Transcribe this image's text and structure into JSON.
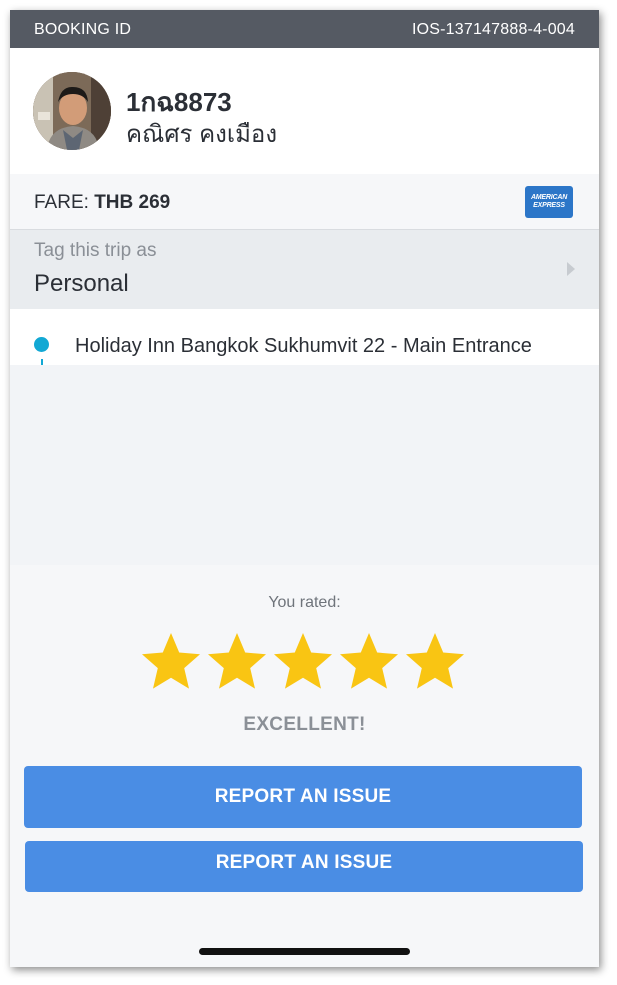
{
  "header": {
    "booking_label": "BOOKING ID",
    "booking_id": "IOS-137147888-4-004"
  },
  "driver": {
    "plate": "1กฉ8873",
    "name": "คณิศร คงเมือง",
    "avatar_icon": "driver-photo"
  },
  "fare": {
    "label": "FARE: ",
    "amount": "THB 269",
    "card_icon": "american-express-card-icon",
    "card_text_line1": "AMERICAN",
    "card_text_line2": "EXPRESS"
  },
  "tag": {
    "hint": "Tag this trip as",
    "value": "Personal"
  },
  "route": {
    "pickup": "Holiday Inn Bangkok Sukhumvit 22 - Main Entrance"
  },
  "rating": {
    "you_rated": "You rated:",
    "stars": 5,
    "stars_max": 5,
    "result": "EXCELLENT!",
    "star_color": "#f9c513"
  },
  "actions": {
    "report_primary": "REPORT AN ISSUE",
    "report_secondary": "REPORT AN ISSUE"
  },
  "colors": {
    "topbar": "#555a63",
    "accent_button": "#4a8de4",
    "pickup_dot": "#12a8d4"
  }
}
